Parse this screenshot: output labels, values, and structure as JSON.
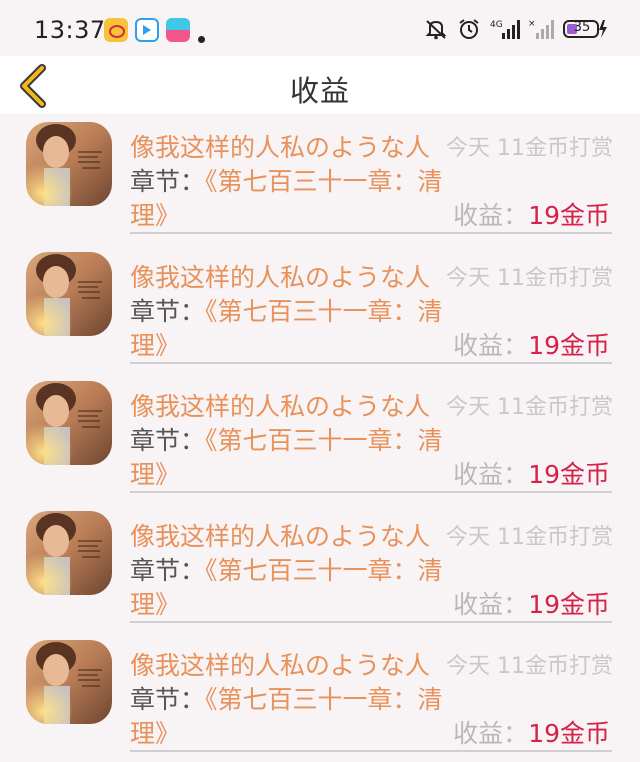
{
  "status_bar": {
    "time": "13:37",
    "battery": "35",
    "network": "4G"
  },
  "header": {
    "title": "收益",
    "back_icon": "chevron-left-icon",
    "accent": "#f4b81b"
  },
  "records": [
    {
      "title": "像我这样的人私のような人",
      "meta": "今天 11金币打赏",
      "chapter_label": "章节：",
      "chapter_part1": "《第七百三十一章：清",
      "chapter_part2": "理》",
      "income_label": "收益：",
      "income_value": "19金币"
    },
    {
      "title": "像我这样的人私のような人",
      "meta": "今天 11金币打赏",
      "chapter_label": "章节：",
      "chapter_part1": "《第七百三十一章：清",
      "chapter_part2": "理》",
      "income_label": "收益：",
      "income_value": "19金币"
    },
    {
      "title": "像我这样的人私のような人",
      "meta": "今天 11金币打赏",
      "chapter_label": "章节：",
      "chapter_part1": "《第七百三十一章：清",
      "chapter_part2": "理》",
      "income_label": "收益：",
      "income_value": "19金币"
    },
    {
      "title": "像我这样的人私のような人",
      "meta": "今天 11金币打赏",
      "chapter_label": "章节：",
      "chapter_part1": "《第七百三十一章：清",
      "chapter_part2": "理》",
      "income_label": "收益：",
      "income_value": "19金币"
    },
    {
      "title": "像我这样的人私のような人",
      "meta": "今天 11金币打赏",
      "chapter_label": "章节：",
      "chapter_part1": "《第七百三十一章：清",
      "chapter_part2": "理》",
      "income_label": "收益：",
      "income_value": "19金币"
    }
  ],
  "colors": {
    "title": "#e8915a",
    "income_value": "#d4224a",
    "meta": "#c8c8c8",
    "background": "#f8f4f6"
  }
}
